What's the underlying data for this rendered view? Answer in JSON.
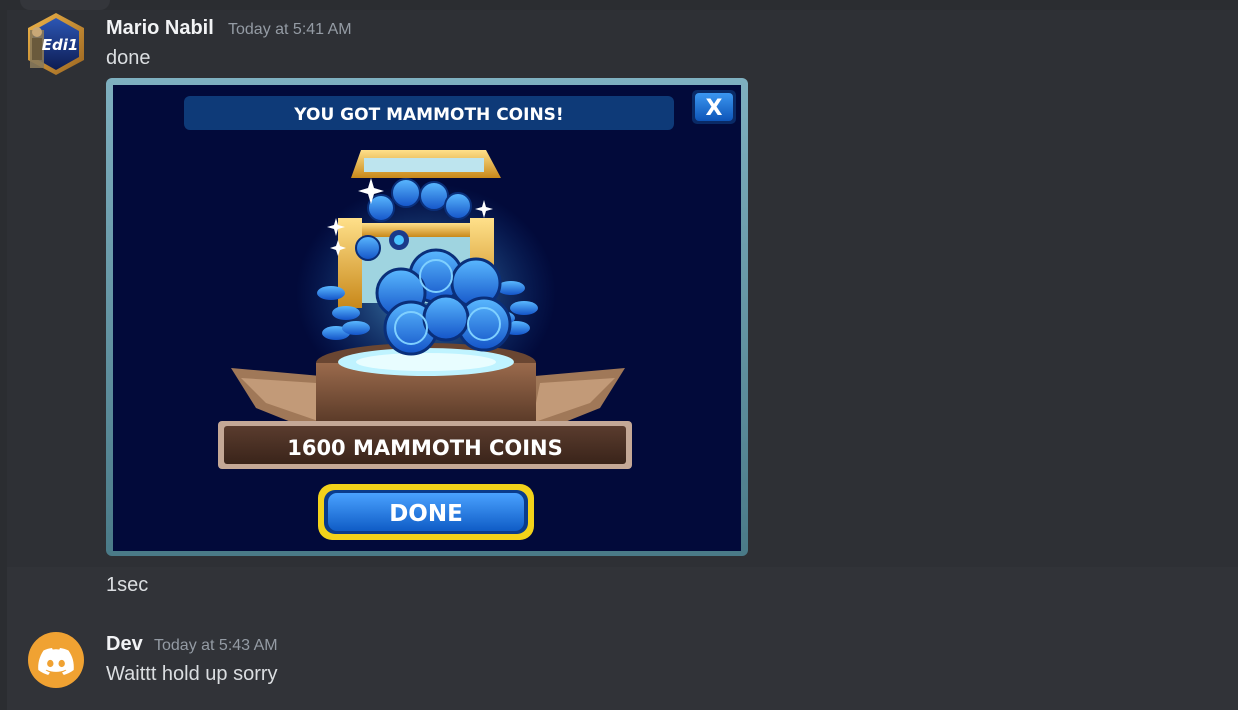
{
  "messages": [
    {
      "author": "Mario Nabil",
      "timestamp": "Today at 5:41 AM",
      "avatar_icon": "hexagon-guild-avatar-icon",
      "avatar_text": "Edi1",
      "lines": [
        "done"
      ]
    },
    {
      "continuation_text": "1sec"
    },
    {
      "author": "Dev",
      "timestamp": "Today at 5:43 AM",
      "avatar_icon": "discord-logo-icon",
      "lines": [
        "Waittt hold up sorry"
      ]
    }
  ],
  "attachment": {
    "popup_title": "YOU GOT MAMMOTH COINS!",
    "close_label": "X",
    "reward_label": "1600 MAMMOTH COINS",
    "done_label": "DONE",
    "reward_amount": 1600
  },
  "colors": {
    "background": "#313338",
    "hover_background": "#2e3035",
    "username": "#f2f3f5",
    "timestamp": "#949ba4",
    "text": "#dbdee1",
    "dev_avatar": "#f0a232",
    "popup_bg": "#020a3a",
    "popup_title_bar": "#0e3a78",
    "done_button": "#1a70d8",
    "done_button_border": "#f3d21a"
  }
}
